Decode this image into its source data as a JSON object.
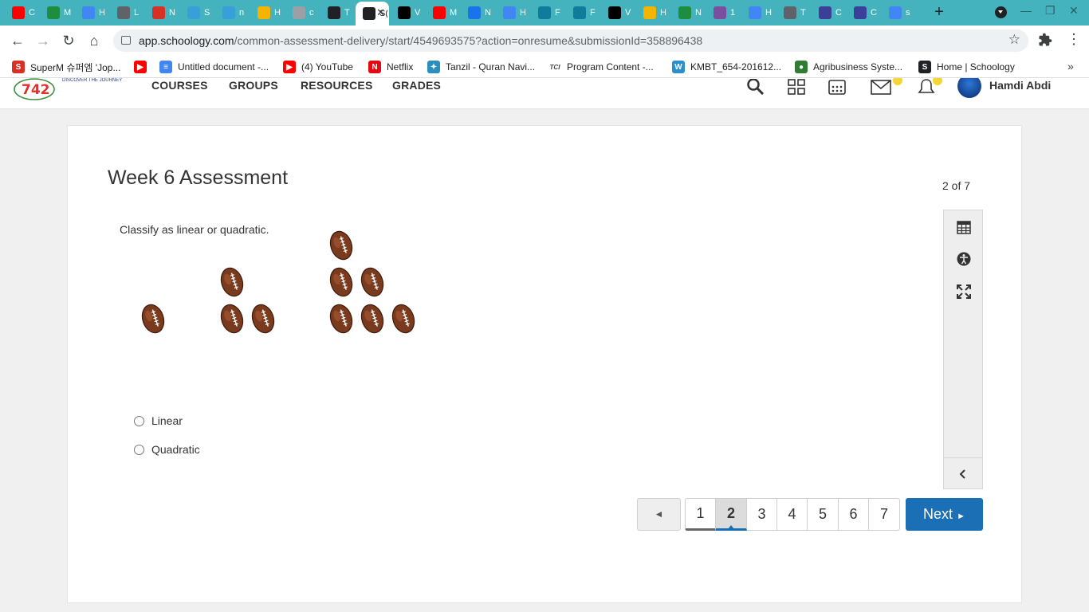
{
  "browser": {
    "tabs": [
      {
        "title": "C",
        "icon": "youtube-icon",
        "color": "#ff0000"
      },
      {
        "title": "M",
        "icon": "classroom-icon",
        "color": "#1e8e3e"
      },
      {
        "title": "H",
        "icon": "docs-icon",
        "color": "#4285f4"
      },
      {
        "title": "L",
        "icon": "lines-icon",
        "color": "#5f6368"
      },
      {
        "title": "N",
        "icon": "m-red-icon",
        "color": "#d93025"
      },
      {
        "title": "S",
        "icon": "molecule-icon",
        "color": "#37a0d9"
      },
      {
        "title": "n",
        "icon": "molecule-icon",
        "color": "#37a0d9"
      },
      {
        "title": "H",
        "icon": "slides-icon",
        "color": "#f4b400"
      },
      {
        "title": "c",
        "icon": "gray-circle-icon",
        "color": "#9aa0a6"
      },
      {
        "title": "T",
        "icon": "schoology-icon",
        "color": "#202124"
      },
      {
        "title": "S(",
        "icon": "schoology-icon",
        "color": "#202124",
        "active": true
      },
      {
        "title": "V",
        "icon": "bold-b-icon",
        "color": "#000000"
      },
      {
        "title": "M",
        "icon": "youtube-icon",
        "color": "#ff0000"
      },
      {
        "title": "N",
        "icon": "book-icon",
        "color": "#1a73e8"
      },
      {
        "title": "H",
        "icon": "docs-icon",
        "color": "#4285f4"
      },
      {
        "title": "F",
        "icon": "r-icon",
        "color": "#0e7c9a"
      },
      {
        "title": "F",
        "icon": "r-icon",
        "color": "#0e7c9a"
      },
      {
        "title": "V",
        "icon": "bold-b-icon",
        "color": "#000000"
      },
      {
        "title": "H",
        "icon": "slides-icon",
        "color": "#f4b400"
      },
      {
        "title": "N",
        "icon": "classroom-icon",
        "color": "#1e8e3e"
      },
      {
        "title": "1",
        "icon": "pdf-icon",
        "color": "#7b4f9e"
      },
      {
        "title": "H",
        "icon": "docs-icon",
        "color": "#4285f4"
      },
      {
        "title": "T",
        "icon": "feather-icon",
        "color": "#5f6368"
      },
      {
        "title": "C",
        "icon": "globe-icon",
        "color": "#3c3f99"
      },
      {
        "title": "C",
        "icon": "globe-icon",
        "color": "#3c3f99"
      },
      {
        "title": "s",
        "icon": "google-icon",
        "color": "#4285f4"
      }
    ],
    "new_tab": "+",
    "url_domain": "app.schoology.com",
    "url_path": "/common-assessment-delivery/start/4549693575?action=onresume&submissionId=358896438",
    "bookmarks": [
      {
        "label": "SuperM 슈퍼엠 'Jop...",
        "icon": "superm-icon",
        "color": "#d93025",
        "glyph": "S"
      },
      {
        "label": "",
        "icon": "youtube-icon",
        "color": "#ff0000",
        "glyph": "▶"
      },
      {
        "label": "Untitled document -...",
        "icon": "docs-icon",
        "color": "#4285f4",
        "glyph": "≡"
      },
      {
        "label": "(4) YouTube",
        "icon": "youtube-icon",
        "color": "#ff0000",
        "glyph": "▶"
      },
      {
        "label": "Netflix",
        "icon": "netflix-icon",
        "color": "#e50914",
        "glyph": "N"
      },
      {
        "label": "Tanzil - Quran Navi...",
        "icon": "tanzil-icon",
        "color": "#2a8fbd",
        "glyph": "✦"
      },
      {
        "label": "Program Content -...",
        "icon": "tci-icon",
        "color": "#444444",
        "glyph": "TCI"
      },
      {
        "label": "KMBT_654-201612...",
        "icon": "weebly-icon",
        "color": "#2a8fcf",
        "glyph": "W"
      },
      {
        "label": "Agribusiness Syste...",
        "icon": "globe-icon",
        "color": "#2e7d32",
        "glyph": "●"
      },
      {
        "label": "Home | Schoology",
        "icon": "schoology-icon",
        "color": "#202124",
        "glyph": "S"
      }
    ],
    "bookmarks_more": "»"
  },
  "header": {
    "logo_text": "742",
    "logo_tagline": "DISCOVER THE JOURNEY",
    "nav": [
      "COURSES",
      "GROUPS",
      "RESOURCES",
      "GRADES"
    ],
    "user_name": "Hamdi Abdi"
  },
  "assessment": {
    "title": "Week 6 Assessment",
    "progress": "2 of 7",
    "question": "Classify as linear or quadratic.",
    "figures": [
      1,
      3,
      6
    ],
    "choices": [
      "Linear",
      "Quadratic"
    ]
  },
  "pager": {
    "prev": "◄",
    "pages": [
      "1",
      "2",
      "3",
      "4",
      "5",
      "6",
      "7"
    ],
    "current_page": "2",
    "next": "Next"
  },
  "colors": {
    "tabstrip": "#44b3bd",
    "primary_button": "#1a6fb5",
    "football": "#7a3a1e"
  }
}
